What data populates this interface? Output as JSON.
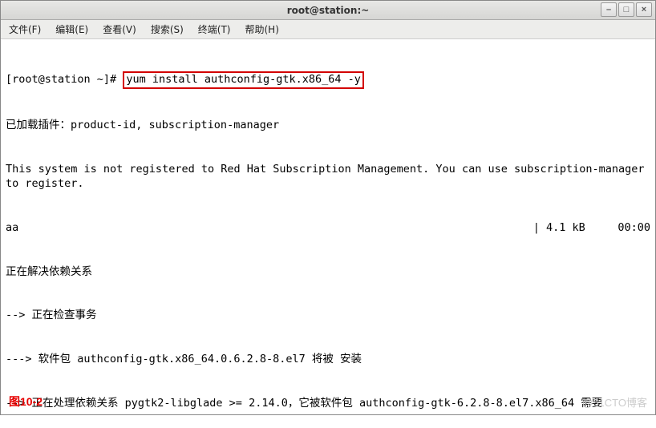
{
  "window": {
    "title": "root@station:~"
  },
  "menu": {
    "file": "文件(F)",
    "edit": "编辑(E)",
    "view": "查看(V)",
    "search": "搜索(S)",
    "terminal": "终端(T)",
    "help": "帮助(H)"
  },
  "terminal": {
    "prompt": "[root@station ~]# ",
    "command": "yum install authconfig-gtk.x86_64 -y",
    "line_plugins": "已加载插件：product-id, subscription-manager",
    "line_notreg": "This system is not registered to Red Hat Subscription Management. You can use subscription-manager to register.",
    "line_aa": "aa",
    "line_aa_size": "| 4.1 kB     00:00",
    "line_resolve": "正在解决依赖关系",
    "line_check": "--> 正在检查事务",
    "line_pkg": "---> 软件包 authconfig-gtk.x86_64.0.6.2.8-8.el7 将被 安装",
    "line_dep": "--> 正在处理依赖关系 pygtk2-libglade >= 2.14.0，它被软件包 authconfig-gtk-6.2.8-8.el7.x86_64 需要"
  },
  "footer": {
    "figure": "图10-2",
    "watermark": "@51CTO博客"
  }
}
